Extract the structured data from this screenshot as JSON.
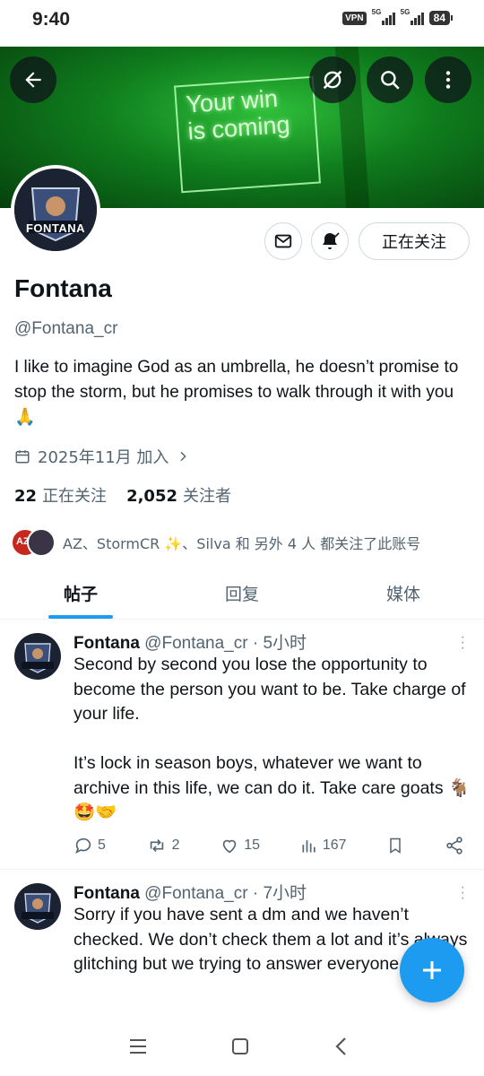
{
  "status": {
    "time": "9:40",
    "vpn": "VPN",
    "net1": "5G",
    "net2": "5G",
    "battery": "84"
  },
  "banner": {
    "sign_line1": "Your win",
    "sign_line2": "is coming"
  },
  "profile": {
    "name": "Fontana",
    "handle": "@Fontana_cr",
    "bio": "I like to imagine God as an umbrella, he doesn’t promise to stop the storm, but he promises to walk through it with you 🙏",
    "joined": "2025年11月 加入",
    "following_count": "22",
    "following_label": "正在关注",
    "followers_count": "2,052",
    "followers_label": "关注者",
    "follow_button": "正在关注",
    "followed_by": "AZ、StormCR ✨、Silva 和 另外 4 人 都关注了此账号",
    "avatar_text": "FONTANA"
  },
  "tabs": [
    "帖子",
    "回复",
    "媒体"
  ],
  "tweets": [
    {
      "name": "Fontana",
      "handle": "@Fontana_cr",
      "time": "· 5小时",
      "text": "Second by second you lose the opportunity to become the person you want to be. Take charge of your life.\n\nIt’s lock in season boys, whatever we want to archive in this life, we can do it. Take care goats 🐐🤩🤝",
      "replies": "5",
      "reposts": "2",
      "likes": "15",
      "views": "167"
    },
    {
      "name": "Fontana",
      "handle": "@Fontana_cr",
      "time": "· 7小时",
      "text": "Sorry if you have sent a dm and we haven’t checked. We don’t check them a lot and it’s always glitching but we trying to answer everyone"
    }
  ],
  "colors": {
    "accent": "#1d9bf0",
    "muted": "#536471",
    "text": "#0f1419",
    "banner": "#0f7d1d"
  }
}
